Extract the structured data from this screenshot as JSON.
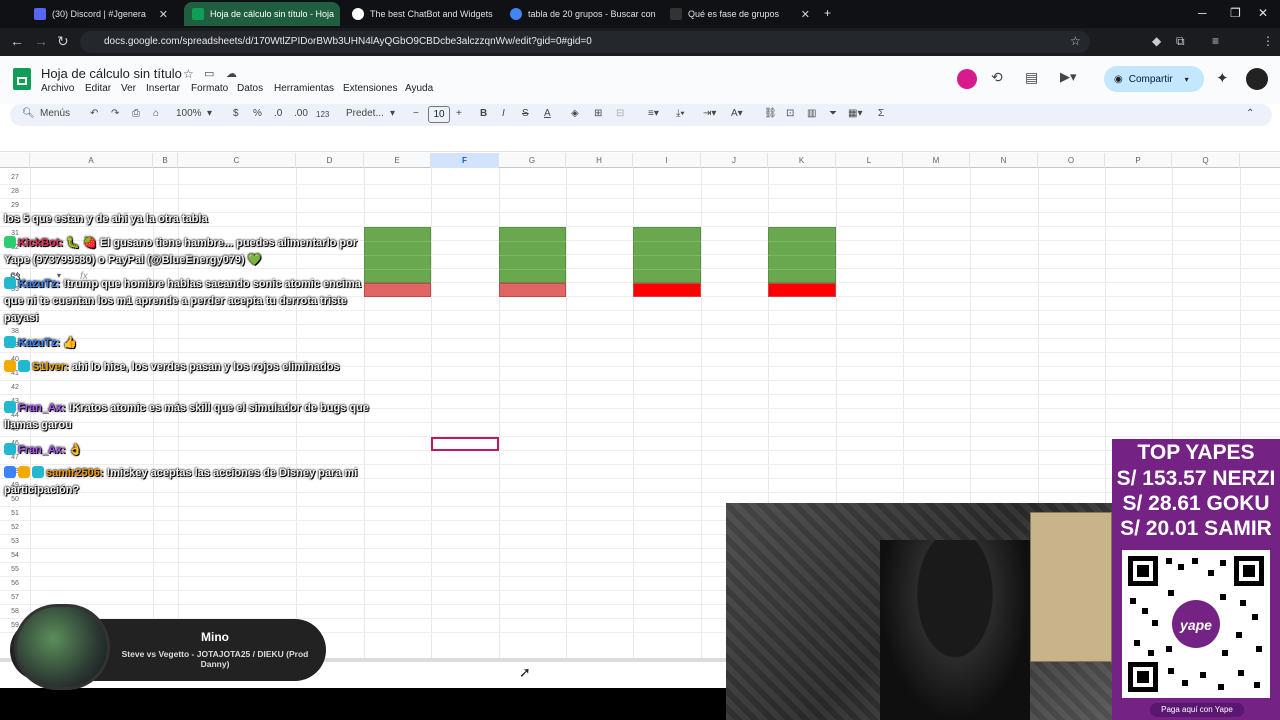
{
  "tabs": [
    {
      "label": "(30) Discord | #Jgenera",
      "fav_color": "#5865f2"
    },
    {
      "label": "Hoja de cálculo sin título - Hoja",
      "fav_color": "#0f9d58"
    },
    {
      "label": "The best ChatBot and Widgets",
      "fav_color": "#ffffff"
    },
    {
      "label": "tabla de 20 grupos - Buscar con",
      "fav_color": "#4285f4"
    },
    {
      "label": "Qué es fase de grupos",
      "fav_color": "#333333"
    }
  ],
  "url": "docs.google.com/spreadsheets/d/170WtlZPIDorBWb3UHN4lAyQGbO9CBDcbe3alczzqnWw/edit?gid=0#gid=0",
  "doc": {
    "title": "Hoja de cálculo sin título",
    "menus": [
      "Archivo",
      "Editar",
      "Ver",
      "Insertar",
      "Formato",
      "Datos",
      "Herramientas",
      "Extensiones",
      "Ayuda"
    ],
    "share_label": "Compartir"
  },
  "toolbar": {
    "menus_label": "Menús",
    "zoom": "100%",
    "currency": "$",
    "percent": "%",
    "dec_less": ".0",
    "dec_more": ".00",
    "num_format": "123",
    "font": "Predet...",
    "font_size": "10"
  },
  "formula": {
    "cell_ref": "F3",
    "fx": "fx"
  },
  "columns": [
    "A",
    "B",
    "C",
    "D",
    "E",
    "F",
    "G",
    "H",
    "I",
    "J",
    "K",
    "L",
    "M",
    "N",
    "O",
    "P",
    "Q"
  ],
  "selected_column": "F",
  "rows": [
    "27",
    "28",
    "29",
    "30",
    "31",
    "32",
    "33",
    "34",
    "35",
    "36",
    "37",
    "38",
    "39",
    "40",
    "41",
    "42",
    "43",
    "44",
    "45",
    "46",
    "47",
    "48",
    "49",
    "50",
    "51",
    "52",
    "53",
    "54",
    "55",
    "56",
    "57",
    "58",
    "59"
  ],
  "chat": [
    {
      "user": "",
      "user_color": "#ffffff",
      "text": "los 5 que estan y de ahi ya la otra tabla"
    },
    {
      "user": "KickBot:",
      "user_color": "#e5335a",
      "text": "🐛 🍓 El gusano tiene hambre... puedes alimentarlo por Yape (973799680) o PayPal (@BlueEnergy079) 💚"
    },
    {
      "user": "KazuTz:",
      "user_color": "#3b82f6",
      "text": "!trump que hombre hablas sacando sonic atomic encima que ni te cuentan los m1 aprende a perder acepta tu derrota triste payasi"
    },
    {
      "user": "KazuTz:",
      "user_color": "#3b82f6",
      "text": "👍"
    },
    {
      "user": "S1lver:",
      "user_color": "#f2a900",
      "text": "ahi lo hice, los verdes pasan y los rojos eliminados"
    },
    {
      "user": "Fran_Ax:",
      "user_color": "#a855f7",
      "text": "!Kratos atomic es más skill que el simulador de bugs que llamas garou"
    },
    {
      "user": "Fran_Ax:",
      "user_color": "#a855f7",
      "text": "👌"
    },
    {
      "user": "samir2506:",
      "user_color": "#f59e0b",
      "text": "!mickey aceptas las acciones de Disney para mi participación?"
    }
  ],
  "music": {
    "title": "Mino",
    "subtitle": "Steve vs Vegetto - JOTAJOTA25 / DIEKU (Prod Danny)"
  },
  "yapes": {
    "heading": "TOP YAPES",
    "entries": [
      "S/ 153.57 NERZI",
      "S/ 28.61 GOKU",
      "S/ 20.01 SAMIR"
    ],
    "footer": "Paga aquí con Yape"
  },
  "colors": {
    "green": "#6aa84f",
    "red": "#e06666",
    "bright_red": "#ff0000",
    "yape_purple": "#742284"
  }
}
